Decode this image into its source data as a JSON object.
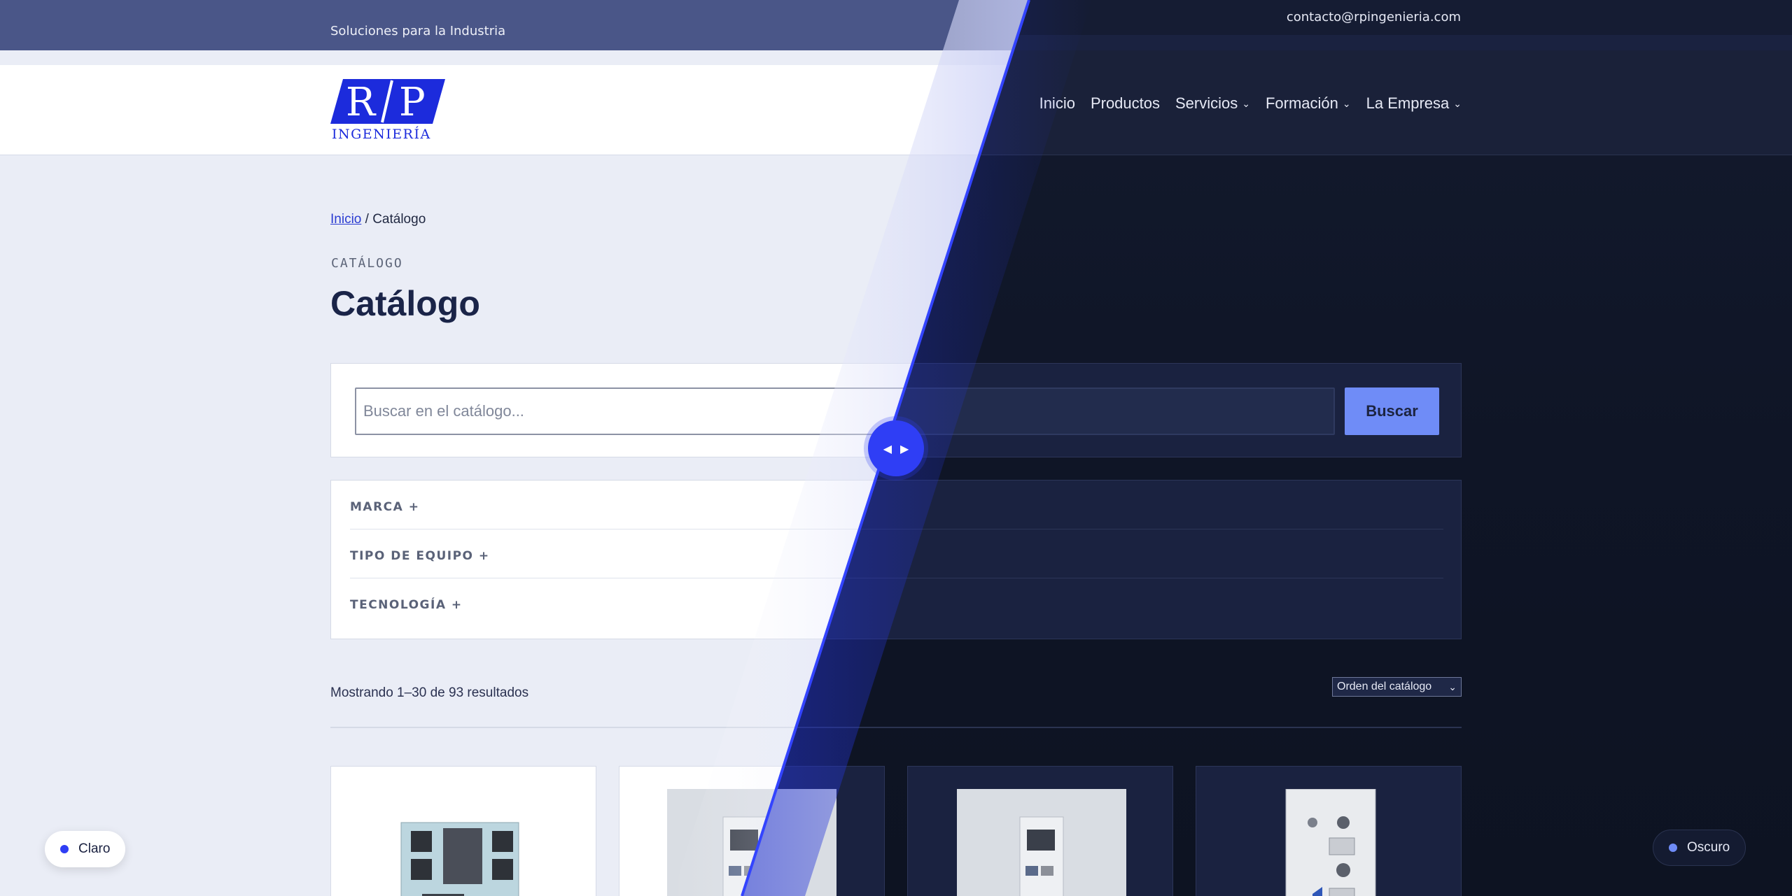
{
  "topbar": {
    "tagline": "Soluciones para la Industria",
    "email": "contacto@rpingenieria.com"
  },
  "logo": {
    "mark": "R/P",
    "subtitle": "INGENIERÍA"
  },
  "nav": {
    "items": [
      {
        "label": "Inicio",
        "has_menu": false
      },
      {
        "label": "Productos",
        "has_menu": false
      },
      {
        "label": "Servicios",
        "has_menu": true
      },
      {
        "label": "Formación",
        "has_menu": true
      },
      {
        "label": "La Empresa",
        "has_menu": true
      }
    ]
  },
  "breadcrumb": {
    "home": "Inicio",
    "separator": " / ",
    "current": "Catálogo"
  },
  "page": {
    "kicker": "CATÁLOGO",
    "title": "Catálogo"
  },
  "search": {
    "placeholder": "Buscar en el catálogo...",
    "button": "Buscar"
  },
  "filters": [
    {
      "label": "MARCA +"
    },
    {
      "label": "TIPO DE EQUIPO +"
    },
    {
      "label": "TECNOLOGÍA +"
    }
  ],
  "results": {
    "summary": "Mostrando 1–30 de 93 resultados",
    "sort_selected": "Orden del catálogo"
  },
  "theme": {
    "light_label": "Claro",
    "dark_label": "Oscuro",
    "accent": "#2f3ef5"
  },
  "icons": {
    "nav_caret": "chevron-down-icon",
    "handle_left": "arrow-left-icon",
    "handle_right": "arrow-right-icon"
  },
  "colors": {
    "brand_blue": "#1c2bdc",
    "button_blue": "#6f8cf7"
  }
}
